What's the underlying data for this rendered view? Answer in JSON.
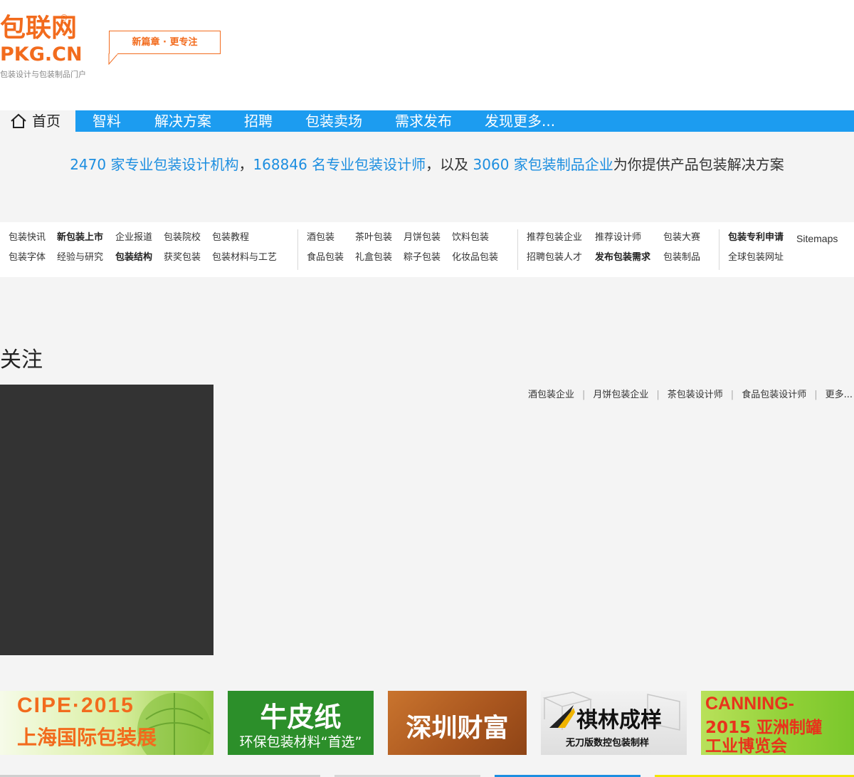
{
  "logo": {
    "name_cn": "包联网",
    "registered": "®",
    "name_en": "PKG.CN",
    "tagline": "包装设计与包装制品门户"
  },
  "slogan": "新篇章 · 更专注",
  "nav": {
    "home": "首页",
    "items": [
      "智料",
      "解决方案",
      "招聘",
      "包装卖场",
      "需求发布",
      "发现更多..."
    ],
    "bg_color": "#1c9cf0"
  },
  "stats": {
    "agencies": "2470 家专业包装设计机构",
    "comma1": "，",
    "designers": "168846 名专业包装设计师",
    "mid": "，以及",
    "companies": "3060 家包装制品企业",
    "tail": "为你提供产品包装解决方案"
  },
  "links": {
    "col1_row1": [
      "包装快讯",
      "新包装上市",
      "企业报道",
      "包装院校",
      "包装教程"
    ],
    "col1_row2": [
      "包装字体",
      "经验与研究",
      "包装结构",
      "获奖包装",
      "包装材料与工艺"
    ],
    "col2_row1": [
      "酒包装",
      "茶叶包装",
      "月饼包装",
      "饮料包装"
    ],
    "col2_row2": [
      "食品包装",
      "礼盒包装",
      "粽子包装",
      "化妆品包装"
    ],
    "col3_row1": [
      "推荐包装企业",
      "推荐设计师",
      "包装大赛"
    ],
    "col3_row2": [
      "招聘包装人才",
      "发布包装需求",
      "包装制品"
    ],
    "col4_row1": [
      "包装专利申请",
      "Sitemaps"
    ],
    "col4_row2": [
      "全球包装网址"
    ]
  },
  "focus": {
    "title": "关注",
    "sub_links": [
      "酒包装企业",
      "月饼包装企业",
      "茶包装设计师",
      "食品包装设计师",
      "更多..."
    ]
  },
  "banners": {
    "cipe_line1": "CIPE·2015",
    "cipe_line2": "上海国际包装展",
    "kraft_line1": "牛皮纸",
    "kraft_line2": "环保包装材料“首选”",
    "shenzhen": "深圳财富",
    "qilin_line1": "祺林成样",
    "qilin_line2": "无刀版数控包装制样",
    "canning_line1": "CANNING-",
    "canning_line2": "2015 亚洲制罐",
    "canning_line3": "工业博览会"
  },
  "colors": {
    "brand_orange": "#f26b1d",
    "link_blue": "#1c8ee0"
  }
}
